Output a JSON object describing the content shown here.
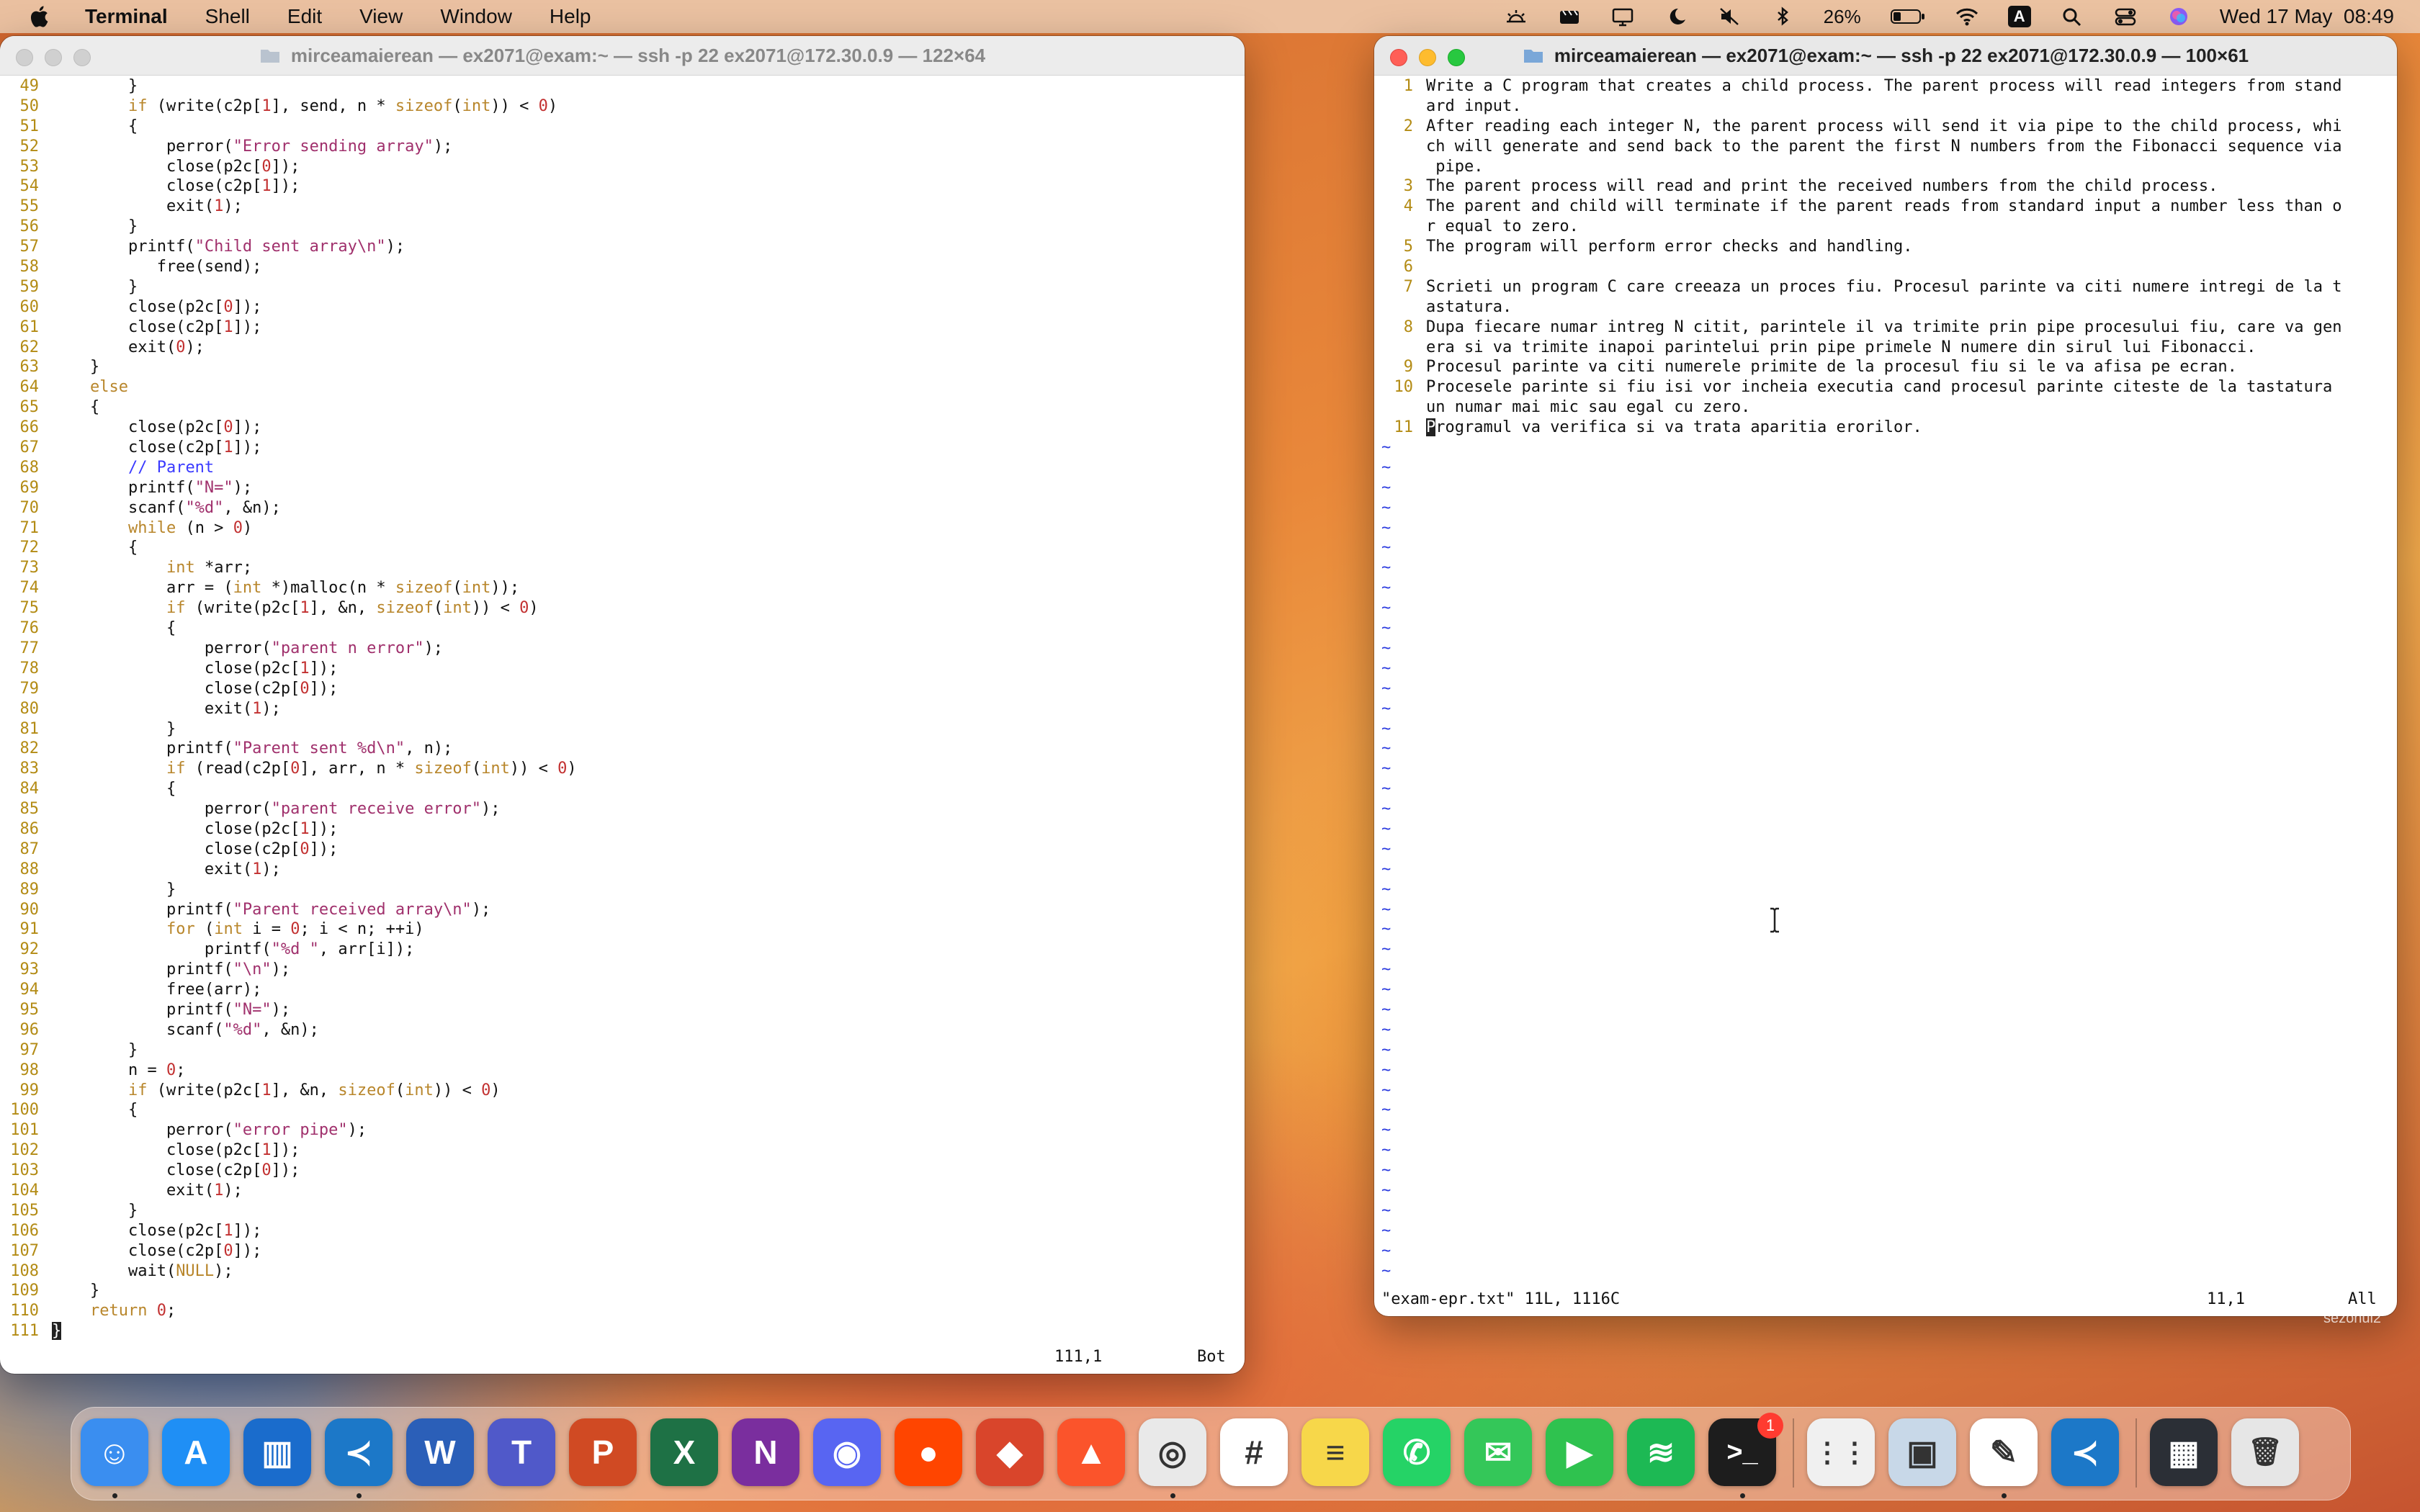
{
  "menubar": {
    "app_name": "Terminal",
    "menus": [
      "Shell",
      "Edit",
      "View",
      "Window",
      "Help"
    ],
    "battery": "26%",
    "datetime": "Wed 17 May  08:49",
    "input_source": "A"
  },
  "left_window": {
    "title": "mirceamaierean — ex2071@exam:~ — ssh -p 22 ex2071@172.30.0.9 — 122×64",
    "status_pos": "111,1",
    "status_scroll": "Bot",
    "lines": [
      {
        "n": "49",
        "t": "        }"
      },
      {
        "n": "50",
        "t": "        if (write(c2p[1], send, n * sizeof(int)) < 0)"
      },
      {
        "n": "51",
        "t": "        {"
      },
      {
        "n": "52",
        "t": "            perror(\"Error sending array\");"
      },
      {
        "n": "53",
        "t": "            close(p2c[0]);"
      },
      {
        "n": "54",
        "t": "            close(c2p[1]);"
      },
      {
        "n": "55",
        "t": "            exit(1);"
      },
      {
        "n": "56",
        "t": "        }"
      },
      {
        "n": "57",
        "t": "        printf(\"Child sent array\\n\");"
      },
      {
        "n": "58",
        "t": "           free(send);"
      },
      {
        "n": "59",
        "t": "        }"
      },
      {
        "n": "60",
        "t": "        close(p2c[0]);"
      },
      {
        "n": "61",
        "t": "        close(c2p[1]);"
      },
      {
        "n": "62",
        "t": "        exit(0);"
      },
      {
        "n": "63",
        "t": "    }"
      },
      {
        "n": "64",
        "t": "    else"
      },
      {
        "n": "65",
        "t": "    {"
      },
      {
        "n": "66",
        "t": "        close(p2c[0]);"
      },
      {
        "n": "67",
        "t": "        close(c2p[1]);"
      },
      {
        "n": "68",
        "t": "        // Parent"
      },
      {
        "n": "69",
        "t": "        printf(\"N=\");"
      },
      {
        "n": "70",
        "t": "        scanf(\"%d\", &n);"
      },
      {
        "n": "71",
        "t": "        while (n > 0)"
      },
      {
        "n": "72",
        "t": "        {"
      },
      {
        "n": "73",
        "t": "            int *arr;"
      },
      {
        "n": "74",
        "t": "            arr = (int *)malloc(n * sizeof(int));"
      },
      {
        "n": "75",
        "t": "            if (write(p2c[1], &n, sizeof(int)) < 0)"
      },
      {
        "n": "76",
        "t": "            {"
      },
      {
        "n": "77",
        "t": "                perror(\"parent n error\");"
      },
      {
        "n": "78",
        "t": "                close(p2c[1]);"
      },
      {
        "n": "79",
        "t": "                close(c2p[0]);"
      },
      {
        "n": "80",
        "t": "                exit(1);"
      },
      {
        "n": "81",
        "t": "            }"
      },
      {
        "n": "82",
        "t": "            printf(\"Parent sent %d\\n\", n);"
      },
      {
        "n": "83",
        "t": "            if (read(c2p[0], arr, n * sizeof(int)) < 0)"
      },
      {
        "n": "84",
        "t": "            {"
      },
      {
        "n": "85",
        "t": "                perror(\"parent receive error\");"
      },
      {
        "n": "86",
        "t": "                close(p2c[1]);"
      },
      {
        "n": "87",
        "t": "                close(c2p[0]);"
      },
      {
        "n": "88",
        "t": "                exit(1);"
      },
      {
        "n": "89",
        "t": "            }"
      },
      {
        "n": "90",
        "t": "            printf(\"Parent received array\\n\");"
      },
      {
        "n": "91",
        "t": "            for (int i = 0; i < n; ++i)"
      },
      {
        "n": "92",
        "t": "                printf(\"%d \", arr[i]);"
      },
      {
        "n": "93",
        "t": "            printf(\"\\n\");"
      },
      {
        "n": "94",
        "t": "            free(arr);"
      },
      {
        "n": "95",
        "t": "            printf(\"N=\");"
      },
      {
        "n": "96",
        "t": "            scanf(\"%d\", &n);"
      },
      {
        "n": "97",
        "t": "        }"
      },
      {
        "n": "98",
        "t": "        n = 0;"
      },
      {
        "n": "99",
        "t": "        if (write(p2c[1], &n, sizeof(int)) < 0)"
      },
      {
        "n": "100",
        "t": "        {"
      },
      {
        "n": "101",
        "t": "            perror(\"error pipe\");"
      },
      {
        "n": "102",
        "t": "            close(p2c[1]);"
      },
      {
        "n": "103",
        "t": "            close(c2p[0]);"
      },
      {
        "n": "104",
        "t": "            exit(1);"
      },
      {
        "n": "105",
        "t": "        }"
      },
      {
        "n": "106",
        "t": "        close(p2c[1]);"
      },
      {
        "n": "107",
        "t": "        close(c2p[0]);"
      },
      {
        "n": "108",
        "t": "        wait(NULL);"
      },
      {
        "n": "109",
        "t": "    }"
      },
      {
        "n": "110",
        "t": "    return 0;"
      },
      {
        "n": "111",
        "t": "}"
      }
    ]
  },
  "right_window": {
    "title": "mirceamaierean — ex2071@exam:~ — ssh -p 22 ex2071@172.30.0.9 — 100×61",
    "status_file": "\"exam-epr.txt\" 11L, 1116C",
    "status_pos": "11,1",
    "status_scroll": "All",
    "lines": [
      {
        "n": "1",
        "t": "Write a C program that creates a child process. The parent process will read integers from stand"
      },
      {
        "n": "",
        "t": "ard input."
      },
      {
        "n": "2",
        "t": "After reading each integer N, the parent process will send it via pipe to the child process, whi"
      },
      {
        "n": "",
        "t": "ch will generate and send back to the parent the first N numbers from the Fibonacci sequence via"
      },
      {
        "n": "",
        "t": " pipe."
      },
      {
        "n": "3",
        "t": "The parent process will read and print the received numbers from the child process."
      },
      {
        "n": "4",
        "t": "The parent and child will terminate if the parent reads from standard input a number less than o"
      },
      {
        "n": "",
        "t": "r equal to zero."
      },
      {
        "n": "5",
        "t": "The program will perform error checks and handling."
      },
      {
        "n": "6",
        "t": ""
      },
      {
        "n": "7",
        "t": "Scrieti un program C care creeaza un proces fiu. Procesul parinte va citi numere intregi de la t"
      },
      {
        "n": "",
        "t": "astatura."
      },
      {
        "n": "8",
        "t": "Dupa fiecare numar intreg N citit, parintele il va trimite prin pipe procesului fiu, care va gen"
      },
      {
        "n": "",
        "t": "era si va trimite inapoi parintelui prin pipe primele N numere din sirul lui Fibonacci."
      },
      {
        "n": "9",
        "t": "Procesul parinte va citi numerele primite de la procesul fiu si le va afisa pe ecran."
      },
      {
        "n": "10",
        "t": "Procesele parinte si fiu isi vor incheia executia cand procesul parinte citeste de la tastatura"
      },
      {
        "n": "",
        "t": "un numar mai mic sau egal cu zero."
      },
      {
        "n": "11",
        "t": "Programul va verifica si va trata aparitia erorilor."
      }
    ],
    "tilde": "~"
  },
  "desktop": {
    "edge_label": "sezonul2"
  },
  "dock": {
    "apps": [
      {
        "name": "Finder",
        "color": "#3a8ef0",
        "glyph": "☺",
        "running": true
      },
      {
        "name": "App Store",
        "color": "#1f8ff5",
        "glyph": "A",
        "running": false
      },
      {
        "name": "Trello",
        "color": "#1a6ccc",
        "glyph": "▥",
        "running": false
      },
      {
        "name": "Visual Studio Code",
        "color": "#1c78c8",
        "glyph": "≺",
        "running": true
      },
      {
        "name": "Word",
        "color": "#2b5fb8",
        "glyph": "W",
        "running": false
      },
      {
        "name": "Teams",
        "color": "#5059c9",
        "glyph": "T",
        "running": false
      },
      {
        "name": "PowerPoint",
        "color": "#d04a23",
        "glyph": "P",
        "running": false
      },
      {
        "name": "Excel",
        "color": "#1e7145",
        "glyph": "X",
        "running": false
      },
      {
        "name": "OneNote",
        "color": "#7a2e9e",
        "glyph": "N",
        "running": false
      },
      {
        "name": "Discord",
        "color": "#5865f2",
        "glyph": "◉",
        "running": false
      },
      {
        "name": "Reddit",
        "color": "#ff4500",
        "glyph": "●",
        "running": false
      },
      {
        "name": "Remote Desktop",
        "color": "#d9452b",
        "glyph": "◆",
        "running": false
      },
      {
        "name": "Brave",
        "color": "#fb542b",
        "glyph": "▲",
        "running": false
      },
      {
        "name": "Chrome",
        "color": "#e9e9e9",
        "glyph": "◎",
        "running": true
      },
      {
        "name": "Slack",
        "color": "#ffffff",
        "glyph": "#",
        "running": false
      },
      {
        "name": "Notes",
        "color": "#f7d74a",
        "glyph": "≡",
        "running": false
      },
      {
        "name": "WhatsApp",
        "color": "#25d366",
        "glyph": "✆",
        "running": false
      },
      {
        "name": "Messages",
        "color": "#34c759",
        "glyph": "✉",
        "running": false
      },
      {
        "name": "FaceTime",
        "color": "#2fc24f",
        "glyph": "▶",
        "running": false
      },
      {
        "name": "Spotify",
        "color": "#1db954",
        "glyph": "≋",
        "running": false
      },
      {
        "name": "Terminal",
        "color": "#1d1d1d",
        "glyph": ">_",
        "running": true,
        "badge": "1"
      },
      {
        "name": "Launchpad",
        "color": "#f0f0f0",
        "glyph": "⋮⋮",
        "running": false
      },
      {
        "name": "Preview",
        "color": "#c8d8e8",
        "glyph": "▣",
        "running": false
      },
      {
        "name": "TextEdit",
        "color": "#ffffff",
        "glyph": "✎",
        "running": true
      },
      {
        "name": "Visual Studio Code",
        "color": "#1c78c8",
        "glyph": "≺",
        "running": false
      },
      {
        "name": "Minimized Window",
        "color": "#2b2f36",
        "glyph": "▦",
        "running": false
      },
      {
        "name": "Trash",
        "color": "#e6e6e6",
        "glyph": "🗑",
        "running": false
      }
    ]
  }
}
